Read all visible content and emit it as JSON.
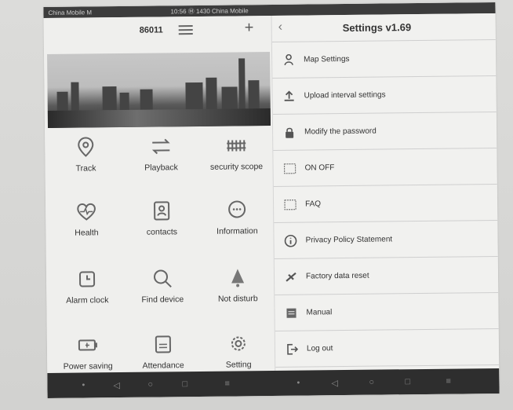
{
  "status_bar": {
    "carrier": "China Mobile M",
    "center": "10:56  Ⓜ  1430  China Mobile"
  },
  "left": {
    "device_id": "86011",
    "icons": [
      {
        "label": "Track",
        "icon": "location-pin-icon"
      },
      {
        "label": "Playback",
        "icon": "playback-icon"
      },
      {
        "label": "security scope",
        "icon": "fence-icon"
      },
      {
        "label": "Health",
        "icon": "heart-icon"
      },
      {
        "label": "contacts",
        "icon": "contacts-icon"
      },
      {
        "label": "Information",
        "icon": "chat-bubble-icon"
      },
      {
        "label": "Alarm clock",
        "icon": "alarm-clock-icon"
      },
      {
        "label": "Find device",
        "icon": "search-icon"
      },
      {
        "label": "Not disturb",
        "icon": "bell-off-icon"
      },
      {
        "label": "Power saving",
        "icon": "battery-icon"
      },
      {
        "label": "Attendance",
        "icon": "attendance-icon"
      },
      {
        "label": "Setting",
        "icon": "gear-icon"
      }
    ]
  },
  "right": {
    "title": "Settings v1.69",
    "items": [
      {
        "label": "Map Settings",
        "icon": "map-settings-icon"
      },
      {
        "label": "Upload interval settings",
        "icon": "upload-icon"
      },
      {
        "label": "Modify the password",
        "icon": "lock-icon"
      },
      {
        "label": "ON OFF",
        "icon": "toggle-icon"
      },
      {
        "label": "FAQ",
        "icon": "faq-icon"
      },
      {
        "label": "Privacy Policy Statement",
        "icon": "info-icon"
      },
      {
        "label": "Factory data reset",
        "icon": "reset-icon"
      },
      {
        "label": "Manual",
        "icon": "manual-icon"
      },
      {
        "label": "Log out",
        "icon": "logout-icon"
      }
    ]
  },
  "colors": {
    "status_bar": "#3c3c3c",
    "navbar": "#2e2e2e",
    "background": "#efefed"
  }
}
